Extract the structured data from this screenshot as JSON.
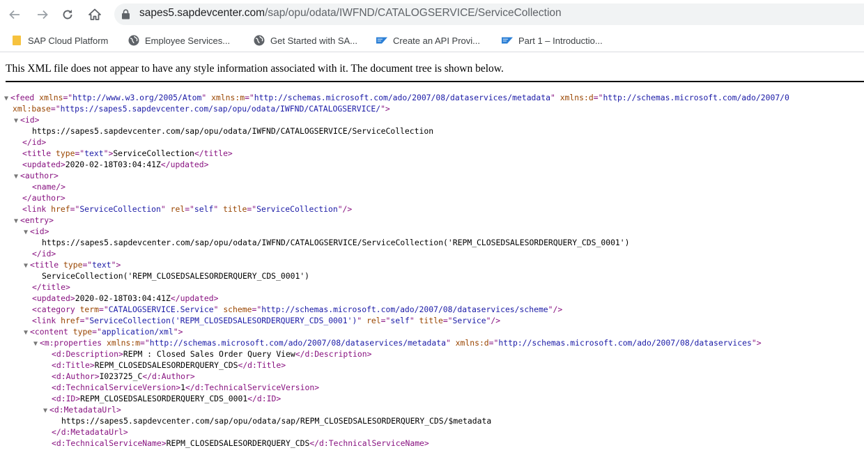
{
  "browser": {
    "url_host": "sapes5.sapdevcenter.com",
    "url_path": "/sap/opu/odata/IWFND/CATALOGSERVICE/ServiceCollection",
    "bookmarks": [
      {
        "label": "SAP Cloud Platform",
        "icon": "folder-icon"
      },
      {
        "label": "Employee Services...",
        "icon": "globe-icon"
      },
      {
        "label": "Get Started with SA...",
        "icon": "globe-icon"
      },
      {
        "label": "Create an API Provi...",
        "icon": "sap-logo-icon"
      },
      {
        "label": "Part 1 – Introductio...",
        "icon": "sap-logo-icon"
      }
    ]
  },
  "notice": "This XML file does not appear to have any style information associated with it. The document tree is shown below.",
  "xml": {
    "ns_atom": "http://www.w3.org/2005/Atom",
    "ns_m": "http://schemas.microsoft.com/ado/2007/08/dataservices/metadata",
    "ns_d_partial": "http://schemas.microsoft.com/ado/2007/0",
    "xml_base": "https://sapes5.sapdevcenter.com/sap/opu/odata/IWFND/CATALOGSERVICE/",
    "feed_id": "https://sapes5.sapdevcenter.com/sap/opu/odata/IWFND/CATALOGSERVICE/ServiceCollection",
    "feed_title": "ServiceCollection",
    "feed_updated": "2020-02-18T03:04:41Z",
    "link_href": "ServiceCollection",
    "link_rel": "self",
    "link_title": "ServiceCollection",
    "entry": {
      "id": "https://sapes5.sapdevcenter.com/sap/opu/odata/IWFND/CATALOGSERVICE/ServiceCollection('REPM_CLOSEDSALESORDERQUERY_CDS_0001')",
      "title": "ServiceCollection('REPM_CLOSEDSALESORDERQUERY_CDS_0001')",
      "updated": "2020-02-18T03:04:41Z",
      "category_term": "CATALOGSERVICE.Service",
      "category_scheme": "http://schemas.microsoft.com/ado/2007/08/dataservices/scheme",
      "link_href": "ServiceCollection('REPM_CLOSEDSALESORDERQUERY_CDS_0001')",
      "link_rel": "self",
      "link_title": "Service",
      "content_type": "application/xml",
      "ns_d": "http://schemas.microsoft.com/ado/2007/08/dataservices",
      "description": "REPM : Closed Sales Order Query View",
      "title_prop": "REPM_CLOSEDSALESORDERQUERY_CDS",
      "author": "I023725_C",
      "tech_version": "1",
      "prop_id": "REPM_CLOSEDSALESORDERQUERY_CDS_0001",
      "metadata_url": "https://sapes5.sapdevcenter.com/sap/opu/odata/sap/REPM_CLOSEDSALESORDERQUERY_CDS/$metadata",
      "tech_service_name": "REPM_CLOSEDSALESORDERQUERY_CDS"
    }
  }
}
